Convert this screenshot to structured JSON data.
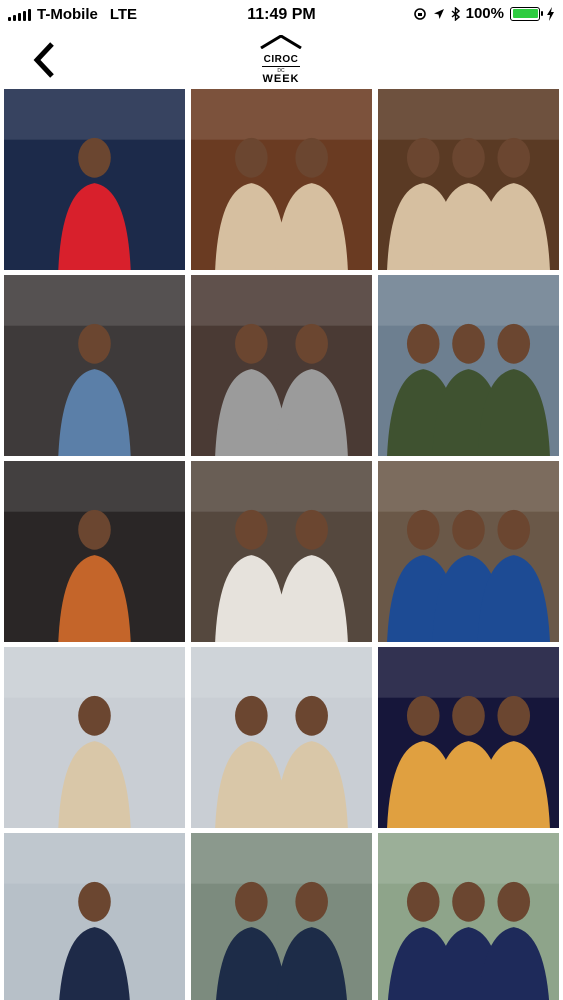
{
  "status_bar": {
    "carrier": "T-Mobile",
    "network": "LTE",
    "time": "11:49 PM",
    "battery": "100%",
    "battery_level": 1.0,
    "battery_color": "#2ecc40"
  },
  "nav": {
    "back_icon": "chevron-left-icon",
    "logo_line1": "CIROC",
    "logo_line2": "DC",
    "logo_line3": "WEEK"
  },
  "gallery": {
    "photos": [
      {
        "name": "photo-sailor-girls",
        "bg": "#1c2a4a",
        "accent": "#d8202c"
      },
      {
        "name": "photo-singer-beige-jacket",
        "bg": "#6a3b22",
        "accent": "#d6bfa0"
      },
      {
        "name": "photo-singer-denim",
        "bg": "#5a3a24",
        "accent": "#d6bfa0"
      },
      {
        "name": "photo-singer-blue-cap",
        "bg": "#3e3a3a",
        "accent": "#5b7fa8"
      },
      {
        "name": "photo-two-women",
        "bg": "#4a3a34",
        "accent": "#9b9b9b"
      },
      {
        "name": "photo-woman-microphone",
        "bg": "#6d7f90",
        "accent": "#3f5230"
      },
      {
        "name": "photo-food-pan",
        "bg": "#2a2626",
        "accent": "#c4652a"
      },
      {
        "name": "photo-two-women-boat",
        "bg": "#55483e",
        "accent": "#e6e2dc"
      },
      {
        "name": "photo-dj",
        "bg": "#6a5848",
        "accent": "#1d4b94"
      },
      {
        "name": "photo-boat-deck-1",
        "bg": "#c9ced4",
        "accent": "#d9c7a8"
      },
      {
        "name": "photo-boat-deck-2",
        "bg": "#c9ced4",
        "accent": "#d9c7a8"
      },
      {
        "name": "photo-bartender",
        "bg": "#16163a",
        "accent": "#e0a040"
      },
      {
        "name": "photo-sailor-bridge",
        "bg": "#b7c0c8",
        "accent": "#1e2a48"
      },
      {
        "name": "photo-selfie-couple",
        "bg": "#7c8b7e",
        "accent": "#1d2c48"
      },
      {
        "name": "photo-two-women-sailor",
        "bg": "#8ea48a",
        "accent": "#1e2a5a"
      }
    ]
  }
}
